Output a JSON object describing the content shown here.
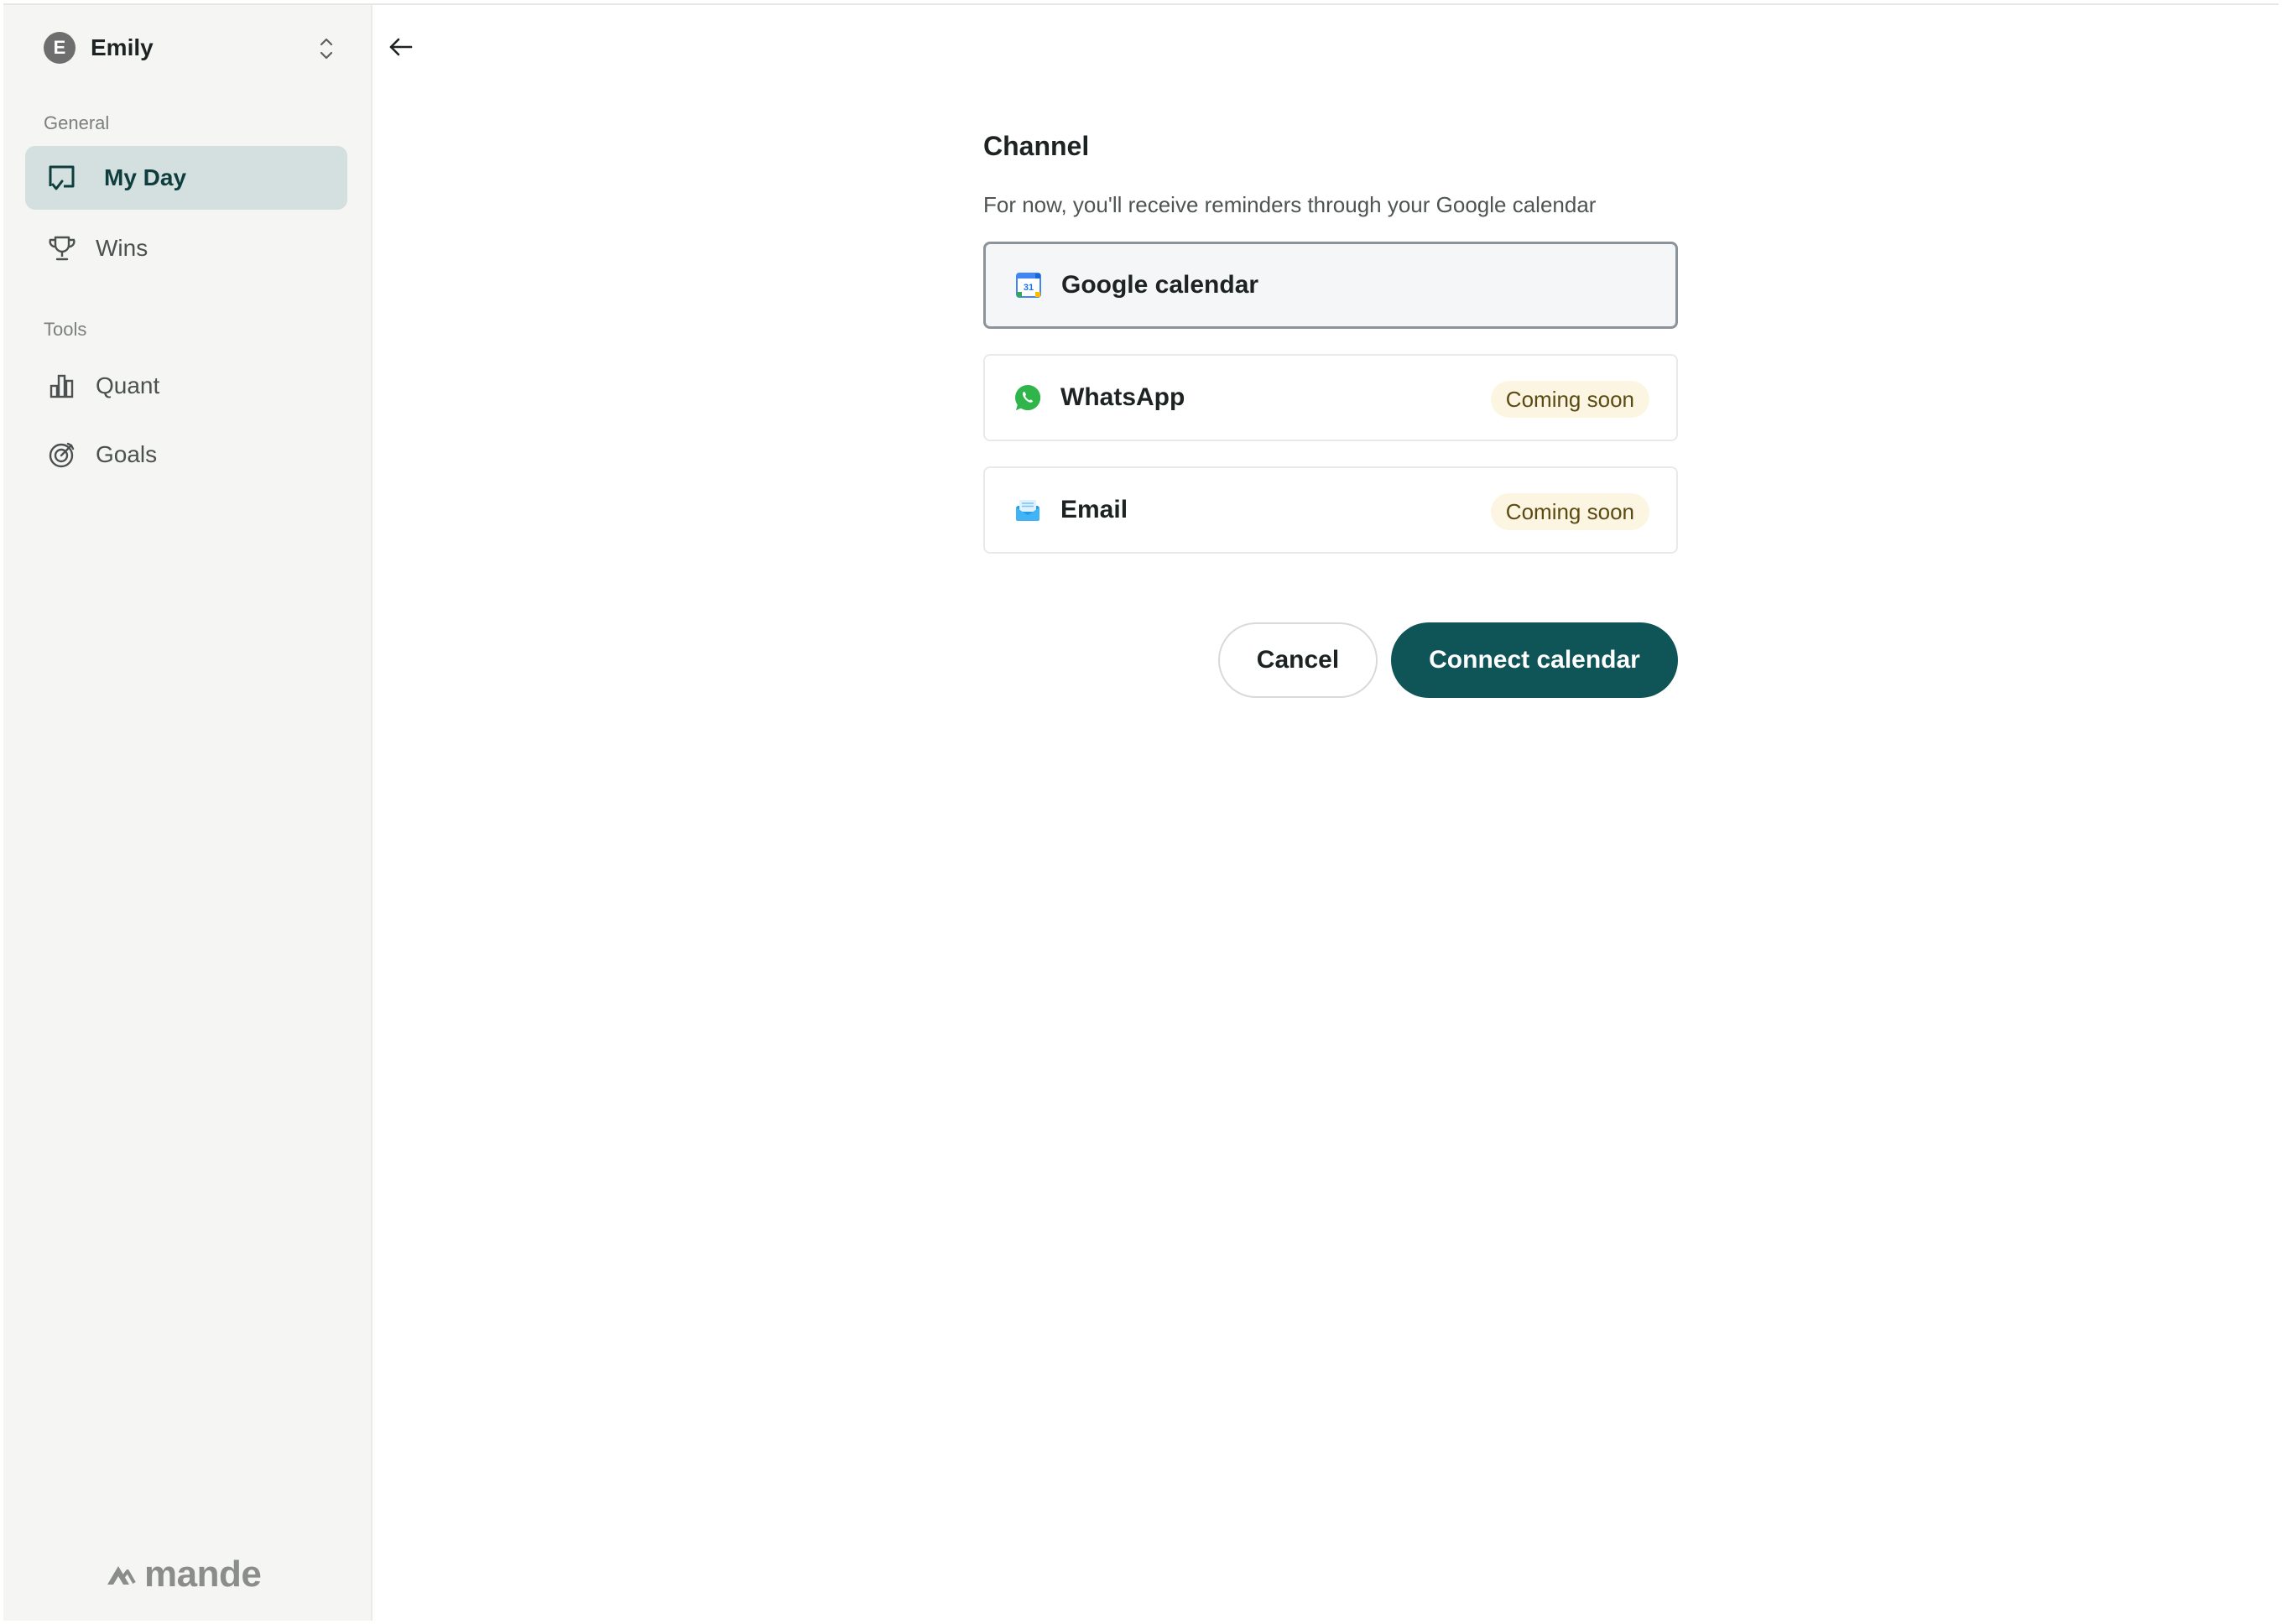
{
  "account": {
    "initial": "E",
    "name": "Emily"
  },
  "sidebar": {
    "general_label": "General",
    "general_items": [
      {
        "label": "My Day",
        "icon": "my-day-icon",
        "active": true
      },
      {
        "label": "Wins",
        "icon": "trophy-icon",
        "active": false
      }
    ],
    "tools_label": "Tools",
    "tools_items": [
      {
        "label": "Quant",
        "icon": "bar-chart-icon",
        "active": false
      },
      {
        "label": "Goals",
        "icon": "target-icon",
        "active": false
      }
    ],
    "brand": "mande"
  },
  "channel": {
    "title": "Channel",
    "description": "For now, you'll receive reminders through your Google calendar",
    "options": [
      {
        "label": "Google calendar",
        "icon": "google-calendar-icon",
        "selected": true,
        "badge": ""
      },
      {
        "label": "WhatsApp",
        "icon": "whatsapp-icon",
        "selected": false,
        "badge": "Coming soon"
      },
      {
        "label": "Email",
        "icon": "email-icon",
        "selected": false,
        "badge": "Coming soon"
      }
    ]
  },
  "actions": {
    "cancel": "Cancel",
    "primary": "Connect calendar"
  },
  "colors": {
    "accent": "#0f5457",
    "active_nav_bg": "#d3e0df",
    "badge_bg": "#fbf5e1",
    "sidebar_bg": "#f5f5f3"
  }
}
